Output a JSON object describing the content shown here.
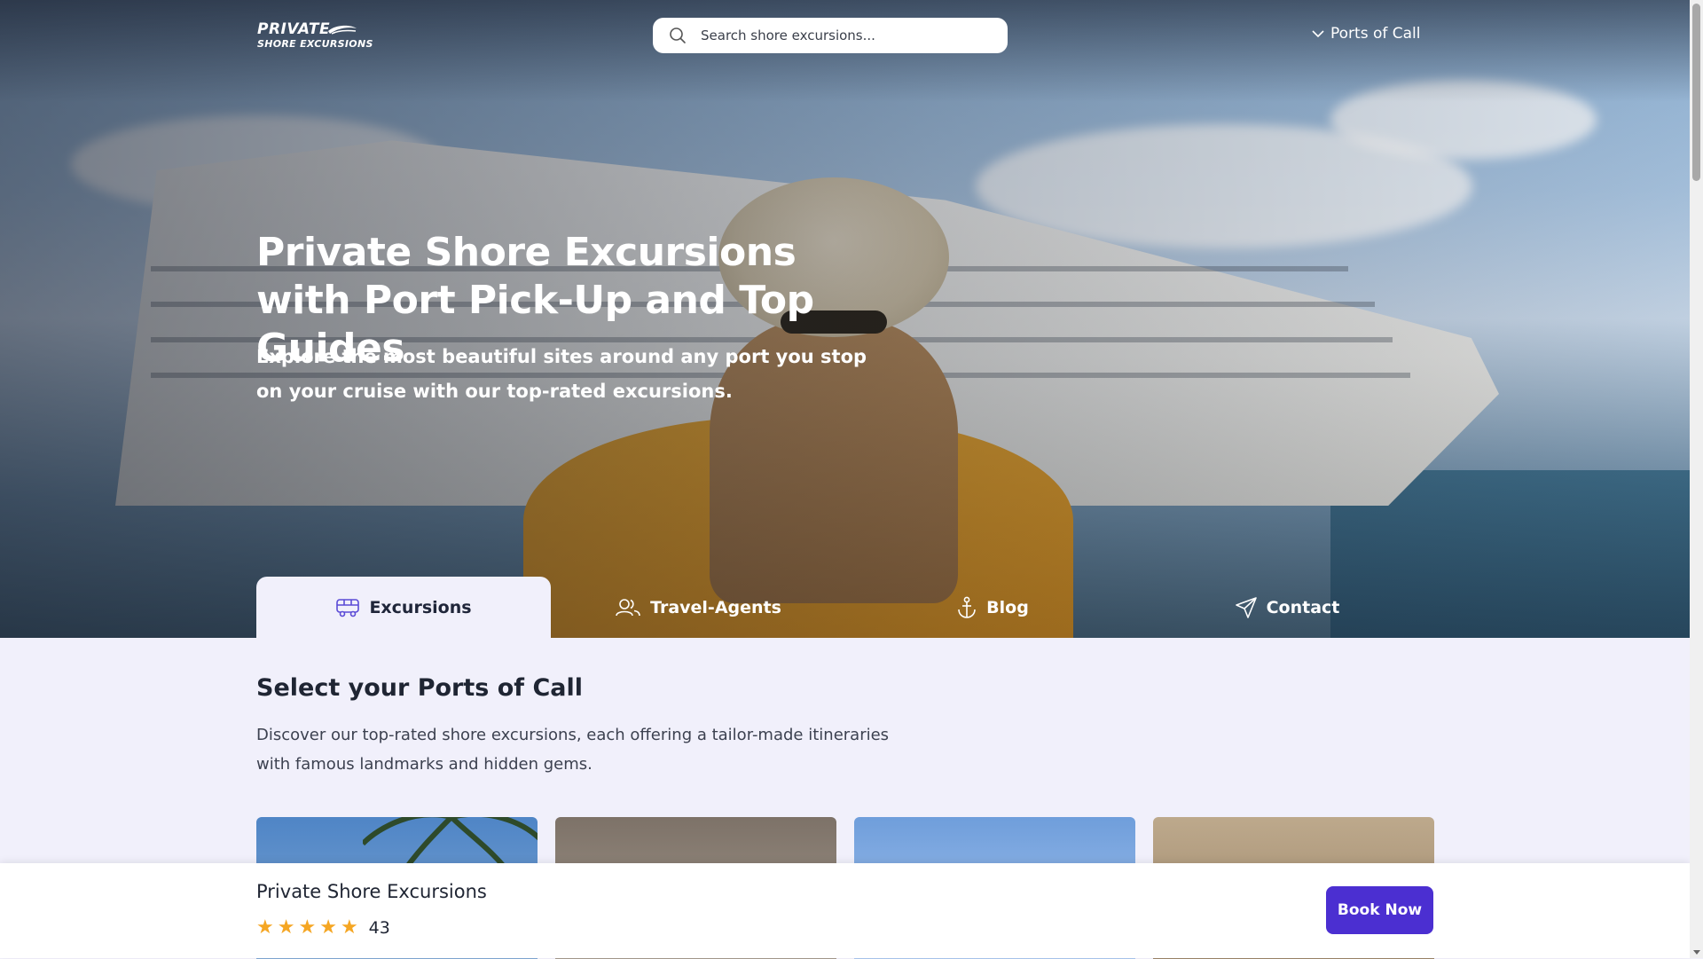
{
  "header": {
    "logo_line1": "PRIVATE",
    "logo_line2": "SHORE EXCURSIONS",
    "search_placeholder": "Search shore excursions...",
    "ports_link": "Ports of Call"
  },
  "hero": {
    "title": "Private Shore Excursions with Port Pick-Up and Top Guides",
    "subtitle": "Explore the most beautiful sites around any port you stop on your cruise with our top-rated excursions."
  },
  "tabs": [
    {
      "label": "Excursions",
      "icon": "bus-icon",
      "active": true
    },
    {
      "label": "Travel-Agents",
      "icon": "users-icon",
      "active": false
    },
    {
      "label": "Blog",
      "icon": "anchor-icon",
      "active": false
    },
    {
      "label": "Contact",
      "icon": "send-icon",
      "active": false
    }
  ],
  "ports_section": {
    "title": "Select your Ports of Call",
    "description": "Discover our top-rated shore excursions, each offering a tailor-made itineraries with famous landmarks and hidden gems."
  },
  "bottom_bar": {
    "title": "Private Shore Excursions",
    "rating_stars": 5,
    "review_count": "43",
    "book_button": "Book Now"
  },
  "colors": {
    "accent": "#4b2fd1",
    "star": "#f5a623",
    "page_bg": "#f1f0fb"
  }
}
